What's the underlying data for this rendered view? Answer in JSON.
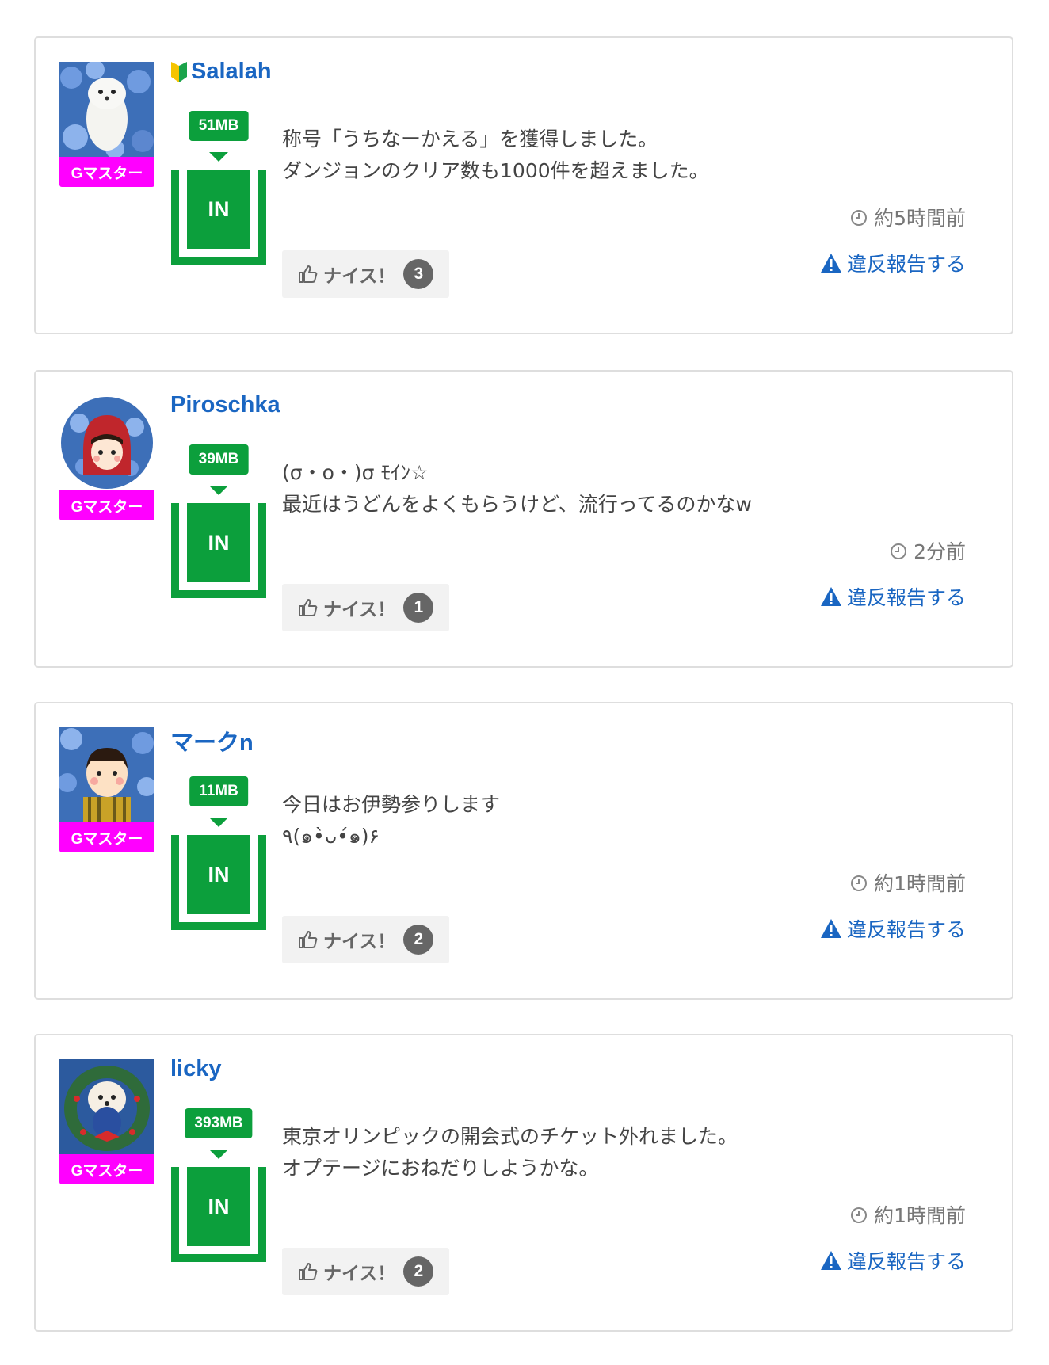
{
  "colors": {
    "username": "#1a66c2",
    "rank_badge": "#ff00ff",
    "storage_green": "#0c9f3c",
    "nice_bg": "#f2f2f2",
    "report_link": "#1a66c2"
  },
  "posts": [
    {
      "username": "Salalah",
      "beginner_mark": true,
      "avatar": "white weasel on blue flowers",
      "rank": "Gマスター",
      "storage": "51MB",
      "in_label": "IN",
      "message_lines": [
        "称号「うちなーかえる」を獲得しました。",
        "ダンジョンのクリア数も1000件を超えました。"
      ],
      "time": "約5時間前",
      "nice_label": "ナイス！",
      "nice_count": "3",
      "report_label": "違反報告する"
    },
    {
      "username": "Piroschka",
      "beginner_mark": false,
      "avatar": "girl in red hood",
      "rank": "Gマスター",
      "storage": "39MB",
      "in_label": "IN",
      "message_lines": [
        "(σ・o・)σ ﾓｲﾝ☆",
        "最近はうどんをよくもらうけど、流行ってるのかなw"
      ],
      "time": "2分前",
      "nice_label": "ナイス！",
      "nice_count": "1",
      "report_label": "違反報告する"
    },
    {
      "username": "マークn",
      "beginner_mark": false,
      "avatar": "boy on blue flowers",
      "rank": "Gマスター",
      "storage": "11MB",
      "in_label": "IN",
      "message_lines": [
        "今日はお伊勢参りします",
        "٩(๑•̀ᴗ•́๑)۶"
      ],
      "time": "約1時間前",
      "nice_label": "ナイス！",
      "nice_count": "2",
      "report_label": "違反報告する"
    },
    {
      "username": "licky",
      "beginner_mark": false,
      "avatar": "white poodle with wreath",
      "rank": "Gマスター",
      "storage": "393MB",
      "in_label": "IN",
      "message_lines": [
        "東京オリンピックの開会式のチケット外れました。",
        "オプテージにおねだりしようかな。"
      ],
      "time": "約1時間前",
      "nice_label": "ナイス！",
      "nice_count": "2",
      "report_label": "違反報告する"
    }
  ]
}
